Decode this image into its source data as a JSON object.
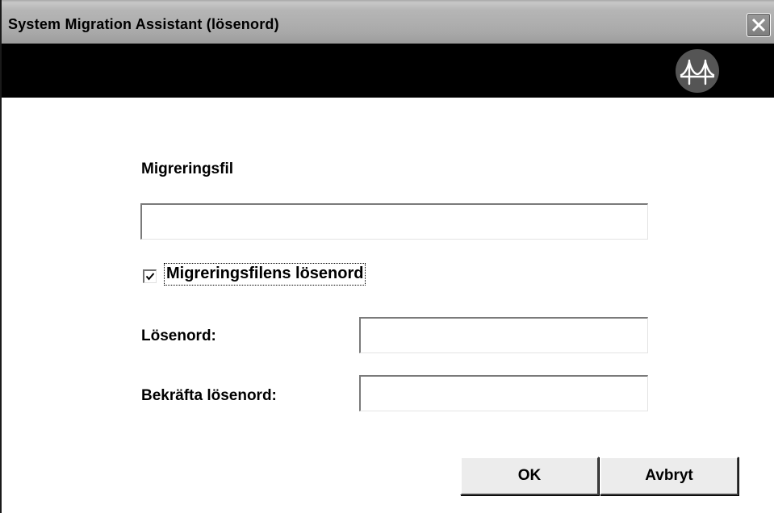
{
  "window": {
    "title": "System Migration Assistant (lösenord)"
  },
  "banner": {
    "logo_icon": "bridge-logo-icon"
  },
  "form": {
    "migration_file_label": "Migreringsfil",
    "migration_file_value": "",
    "password_checkbox_label": "Migreringsfilens lösenord",
    "password_checkbox_checked": true,
    "password_label": "Lösenord:",
    "password_value": "",
    "confirm_password_label": "Bekräfta lösenord:",
    "confirm_password_value": ""
  },
  "buttons": {
    "ok_label": "OK",
    "cancel_label": "Avbryt"
  }
}
